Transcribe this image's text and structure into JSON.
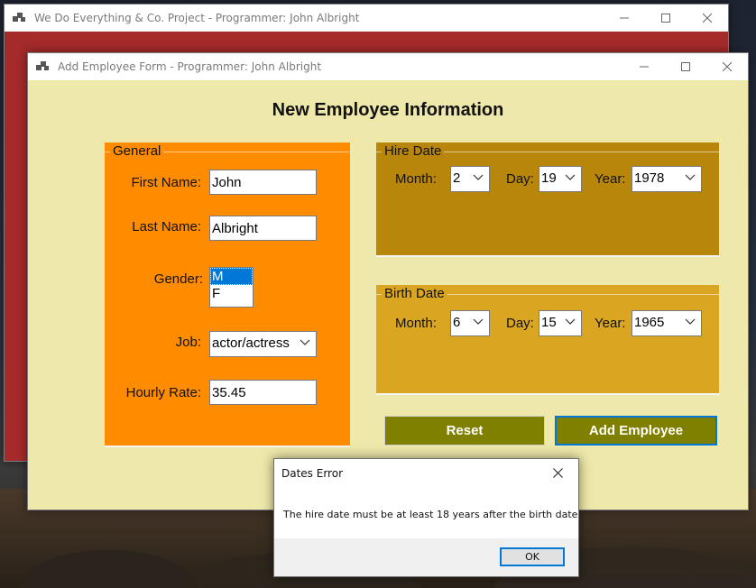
{
  "back_window": {
    "title": "We Do Everything & Co. Project - Programmer: John Albright"
  },
  "form_window": {
    "title": "Add Employee Form - Programmer: John Albright",
    "heading": "New Employee Information"
  },
  "general": {
    "title": "General",
    "first_name_label": "First Name:",
    "first_name_value": "John",
    "last_name_label": "Last Name:",
    "last_name_value": "Albright",
    "gender_label": "Gender:",
    "gender_options": [
      "M",
      "F"
    ],
    "gender_selected": "M",
    "job_label": "Job:",
    "job_value": "actor/actress",
    "hourly_rate_label": "Hourly Rate:",
    "hourly_rate_value": "35.45"
  },
  "hire_date": {
    "title": "Hire Date",
    "month_label": "Month:",
    "month_value": "2",
    "day_label": "Day:",
    "day_value": "19",
    "year_label": "Year:",
    "year_value": "1978"
  },
  "birth_date": {
    "title": "Birth Date",
    "month_label": "Month:",
    "month_value": "6",
    "day_label": "Day:",
    "day_value": "15",
    "year_label": "Year:",
    "year_value": "1965"
  },
  "buttons": {
    "reset": "Reset",
    "add_employee": "Add Employee"
  },
  "dialog": {
    "title": "Dates Error",
    "message": "The hire date must be at least 18 years after the birth date",
    "ok": "OK"
  },
  "colors": {
    "back_window_bg": "#a52a2a",
    "form_bg": "#eee8aa",
    "general_bg": "#ff8c00",
    "hire_bg": "#b8860b",
    "birth_bg": "#daa520",
    "button_bg": "#808000",
    "selection": "#0078d7"
  },
  "icons": {
    "app": "app-window-icon",
    "minimize": "minimize-icon",
    "maximize": "maximize-icon",
    "close": "close-icon",
    "dropdown": "chevron-down-icon"
  }
}
